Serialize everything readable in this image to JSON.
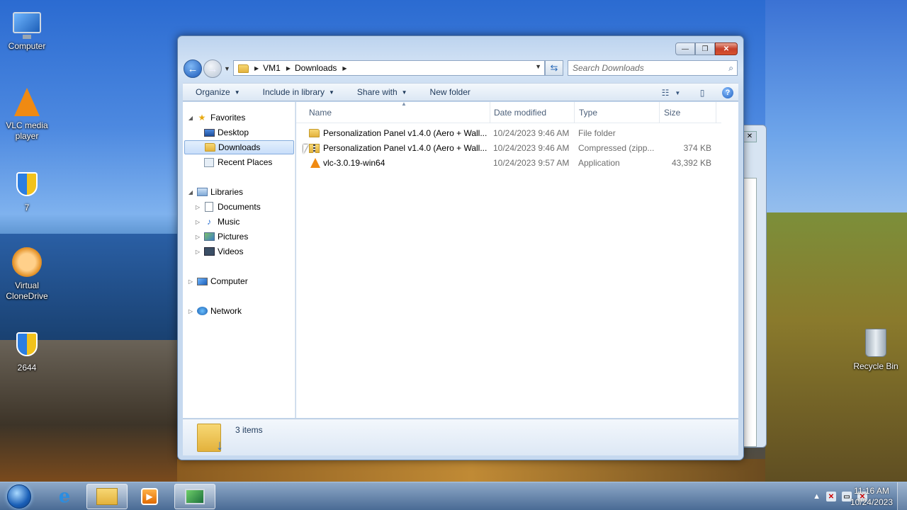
{
  "desktop": {
    "icons": [
      {
        "label": "Computer",
        "icon": "computer-icon"
      },
      {
        "label": "VLC media player",
        "icon": "vlc-cone-icon"
      },
      {
        "label": "7",
        "icon": "shield-shortcut-icon"
      },
      {
        "label": "Virtual CloneDrive",
        "icon": "sheep-icon"
      },
      {
        "label": "2644",
        "icon": "shield-shortcut-icon"
      },
      {
        "label": "Recycle Bin",
        "icon": "recycle-bin-icon"
      }
    ]
  },
  "window": {
    "caption_buttons": {
      "minimize": "—",
      "maximize": "❐",
      "close": "✕"
    },
    "address": {
      "segments": [
        "VM1",
        "Downloads"
      ]
    },
    "search": {
      "placeholder": "Search Downloads"
    },
    "toolbar": {
      "organize": "Organize",
      "include_in_library": "Include in library",
      "share_with": "Share with",
      "new_folder": "New folder"
    },
    "nav_pane": {
      "favorites": {
        "label": "Favorites",
        "items": [
          "Desktop",
          "Downloads",
          "Recent Places"
        ]
      },
      "libraries": {
        "label": "Libraries",
        "items": [
          "Documents",
          "Music",
          "Pictures",
          "Videos"
        ]
      },
      "computer": "Computer",
      "network": "Network",
      "selected": "Downloads"
    },
    "columns": [
      "Name",
      "Date modified",
      "Type",
      "Size"
    ],
    "files": [
      {
        "name": "Personalization Panel v1.4.0 (Aero + Wall...",
        "date": "10/24/2023 9:46 AM",
        "type": "File folder",
        "size": "",
        "icon": "folder-icon"
      },
      {
        "name": "Personalization Panel v1.4.0 (Aero + Wall...",
        "date": "10/24/2023 9:46 AM",
        "type": "Compressed (zipp...",
        "size": "374 KB",
        "icon": "zip-folder-icon"
      },
      {
        "name": "vlc-3.0.19-win64",
        "date": "10/24/2023 9:57 AM",
        "type": "Application",
        "size": "43,392 KB",
        "icon": "vlc-cone-icon"
      }
    ],
    "status": {
      "items_count": "3 items"
    }
  },
  "taskbar": {
    "clock_time": "11:16 AM",
    "clock_date": "10/24/2023"
  }
}
